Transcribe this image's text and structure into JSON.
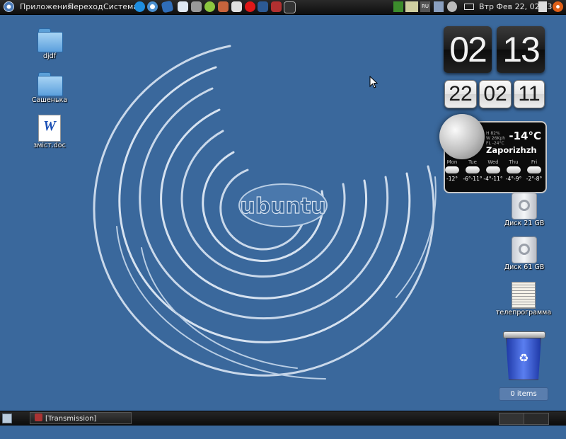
{
  "top_panel": {
    "menus": [
      "Приложения",
      "Переход",
      "Система"
    ],
    "clock": "Втр Фев 22, 02:13",
    "layout_indicator": "RU",
    "launchers": [
      "skype-icon",
      "safari-icon",
      "mail-icon",
      "chat-icon",
      "settings-icon",
      "help-icon",
      "archive-icon",
      "photo-icon",
      "opera-icon",
      "gaming-icon",
      "transmission-icon",
      "terminal-icon"
    ]
  },
  "desktop_icons": {
    "left": [
      {
        "label": "djdf",
        "icon": "folder-icon"
      },
      {
        "label": "Сашенька",
        "icon": "folder-icon"
      },
      {
        "label": "зміст.doc",
        "icon": "word-document-icon"
      }
    ],
    "right": [
      {
        "label": "Диск 21 GB",
        "icon": "disk-icon"
      },
      {
        "label": "Диск 61 GB",
        "icon": "disk-icon"
      },
      {
        "label": "телепрограмма",
        "icon": "newspaper-icon"
      }
    ]
  },
  "wallpaper": {
    "logo_text": "ubuntu"
  },
  "flip_clock": {
    "hours": "02",
    "minutes": "13",
    "day": "22",
    "month": "02",
    "year": "11"
  },
  "weather": {
    "temperature": "-14°C",
    "city": "Zaporizhzh",
    "details": [
      "H 82%",
      "W 26Kph",
      "FL -24°C"
    ],
    "forecast": [
      {
        "day": "Mon",
        "temp": "-12°"
      },
      {
        "day": "Tue",
        "temp": "-6°-11°"
      },
      {
        "day": "Wed",
        "temp": "-4°-11°"
      },
      {
        "day": "Thu",
        "temp": "-4°-9°"
      },
      {
        "day": "Fri",
        "temp": "-2°-8°"
      }
    ]
  },
  "trash": {
    "items_label": "0 items"
  },
  "bottom_panel": {
    "task_label": "[Transmission]"
  },
  "colors": {
    "desktop": "#3a689c",
    "panel": "#1a1a1a"
  }
}
